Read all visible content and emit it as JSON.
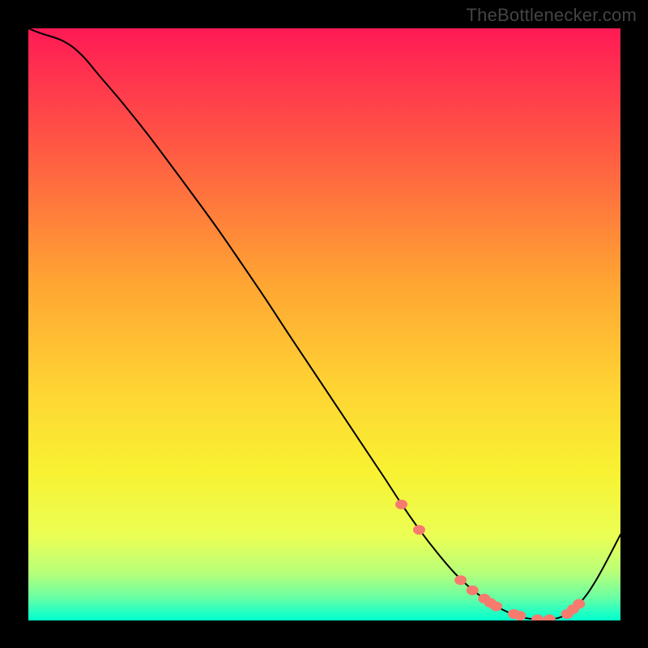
{
  "chart_data": {
    "type": "line",
    "title": "",
    "xlabel": "",
    "ylabel": "",
    "xlim": [
      0,
      100
    ],
    "ylim": [
      0,
      100
    ],
    "x": [
      0,
      2,
      6,
      9,
      12,
      16,
      20,
      24,
      28,
      32,
      36,
      40,
      44,
      48,
      52,
      56,
      60,
      63,
      66,
      69,
      72,
      75,
      78,
      81,
      84,
      87,
      90,
      93,
      96,
      100
    ],
    "values": [
      100,
      99.2,
      97.8,
      95.5,
      92.0,
      87.3,
      82.3,
      77.0,
      71.6,
      66.1,
      60.3,
      54.4,
      48.3,
      42.3,
      36.3,
      30.3,
      24.3,
      19.7,
      15.4,
      11.5,
      8.0,
      5.2,
      3.0,
      1.4,
      0.4,
      0.2,
      0.6,
      2.8,
      7.0,
      14.5
    ],
    "markers_x": [
      63.0,
      66.0,
      73.0,
      75.0,
      77.0,
      78.0,
      79.0,
      82.0,
      83.0,
      86.0,
      88.0,
      91.0,
      92.0,
      93.0
    ],
    "markers_y": [
      19.6,
      15.3,
      6.8,
      5.1,
      3.7,
      3.0,
      2.4,
      1.1,
      0.8,
      0.2,
      0.2,
      1.1,
      1.9,
      2.8
    ],
    "marker_color": "#f77a6f",
    "watermark": "TheBottlenecker.com",
    "gradient_stops": [
      {
        "offset": 0.0,
        "color": "#ff1a55"
      },
      {
        "offset": 0.2,
        "color": "#ff5844"
      },
      {
        "offset": 0.42,
        "color": "#ffa233"
      },
      {
        "offset": 0.6,
        "color": "#ffd233"
      },
      {
        "offset": 0.75,
        "color": "#f8f232"
      },
      {
        "offset": 0.86,
        "color": "#eaff55"
      },
      {
        "offset": 0.92,
        "color": "#b6ff7a"
      },
      {
        "offset": 0.96,
        "color": "#6cffa2"
      },
      {
        "offset": 0.985,
        "color": "#26ffc2"
      },
      {
        "offset": 1.0,
        "color": "#00ffcc"
      }
    ]
  }
}
